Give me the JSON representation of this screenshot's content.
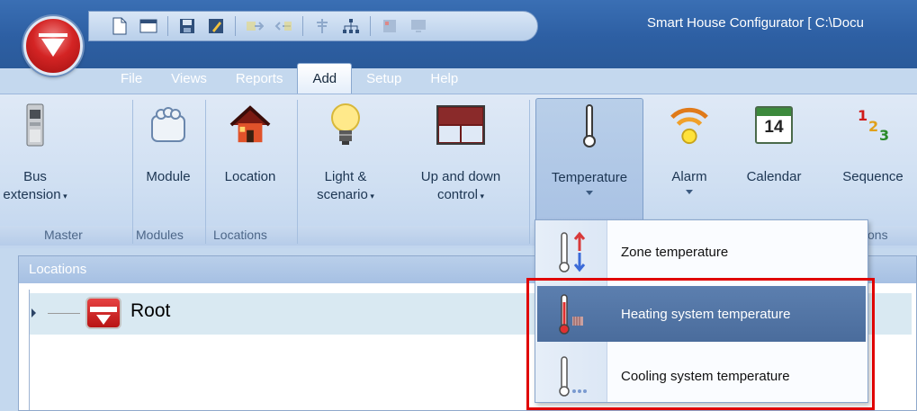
{
  "window": {
    "title": "Smart House Configurator [ C:\\Docu"
  },
  "quick_access": {
    "icons": [
      "new-file-icon",
      "open-icon",
      "save-icon",
      "edit-icon",
      "export-icon",
      "import-icon",
      "antenna-icon",
      "network-icon",
      "panel-icon",
      "monitor-icon"
    ]
  },
  "menu": {
    "tabs": [
      {
        "label": "File"
      },
      {
        "label": "Views"
      },
      {
        "label": "Reports"
      },
      {
        "label": "Add",
        "active": true
      },
      {
        "label": "Setup"
      },
      {
        "label": "Help"
      }
    ]
  },
  "ribbon": {
    "buttons": {
      "bus_extension": {
        "line1": "Bus",
        "line2": "extension"
      },
      "module": {
        "label": "Module"
      },
      "location": {
        "label": "Location"
      },
      "light": {
        "line1": "Light &",
        "line2": "scenario"
      },
      "updown": {
        "line1": "Up and down",
        "line2": "control"
      },
      "temperature": {
        "label": "Temperature"
      },
      "alarm": {
        "label": "Alarm"
      },
      "calendar": {
        "label": "Calendar",
        "day": "14"
      },
      "sequence": {
        "label": "Sequence",
        "digits": [
          "1",
          "2",
          "3"
        ]
      }
    },
    "groups": {
      "master": "Master",
      "modules": "Modules",
      "locations": "Locations",
      "functions_tail": "ons"
    }
  },
  "panel": {
    "title": "Locations",
    "tree": {
      "root_label": "Root"
    }
  },
  "dropdown": {
    "items": [
      {
        "label": "Zone temperature"
      },
      {
        "label": "Heating system temperature",
        "highlighted": true
      },
      {
        "label": "Cooling system temperature"
      }
    ]
  },
  "colors": {
    "highlight": "#e00000",
    "selected_item": "#4f72a3",
    "title_bar": "#2d5fa3"
  }
}
